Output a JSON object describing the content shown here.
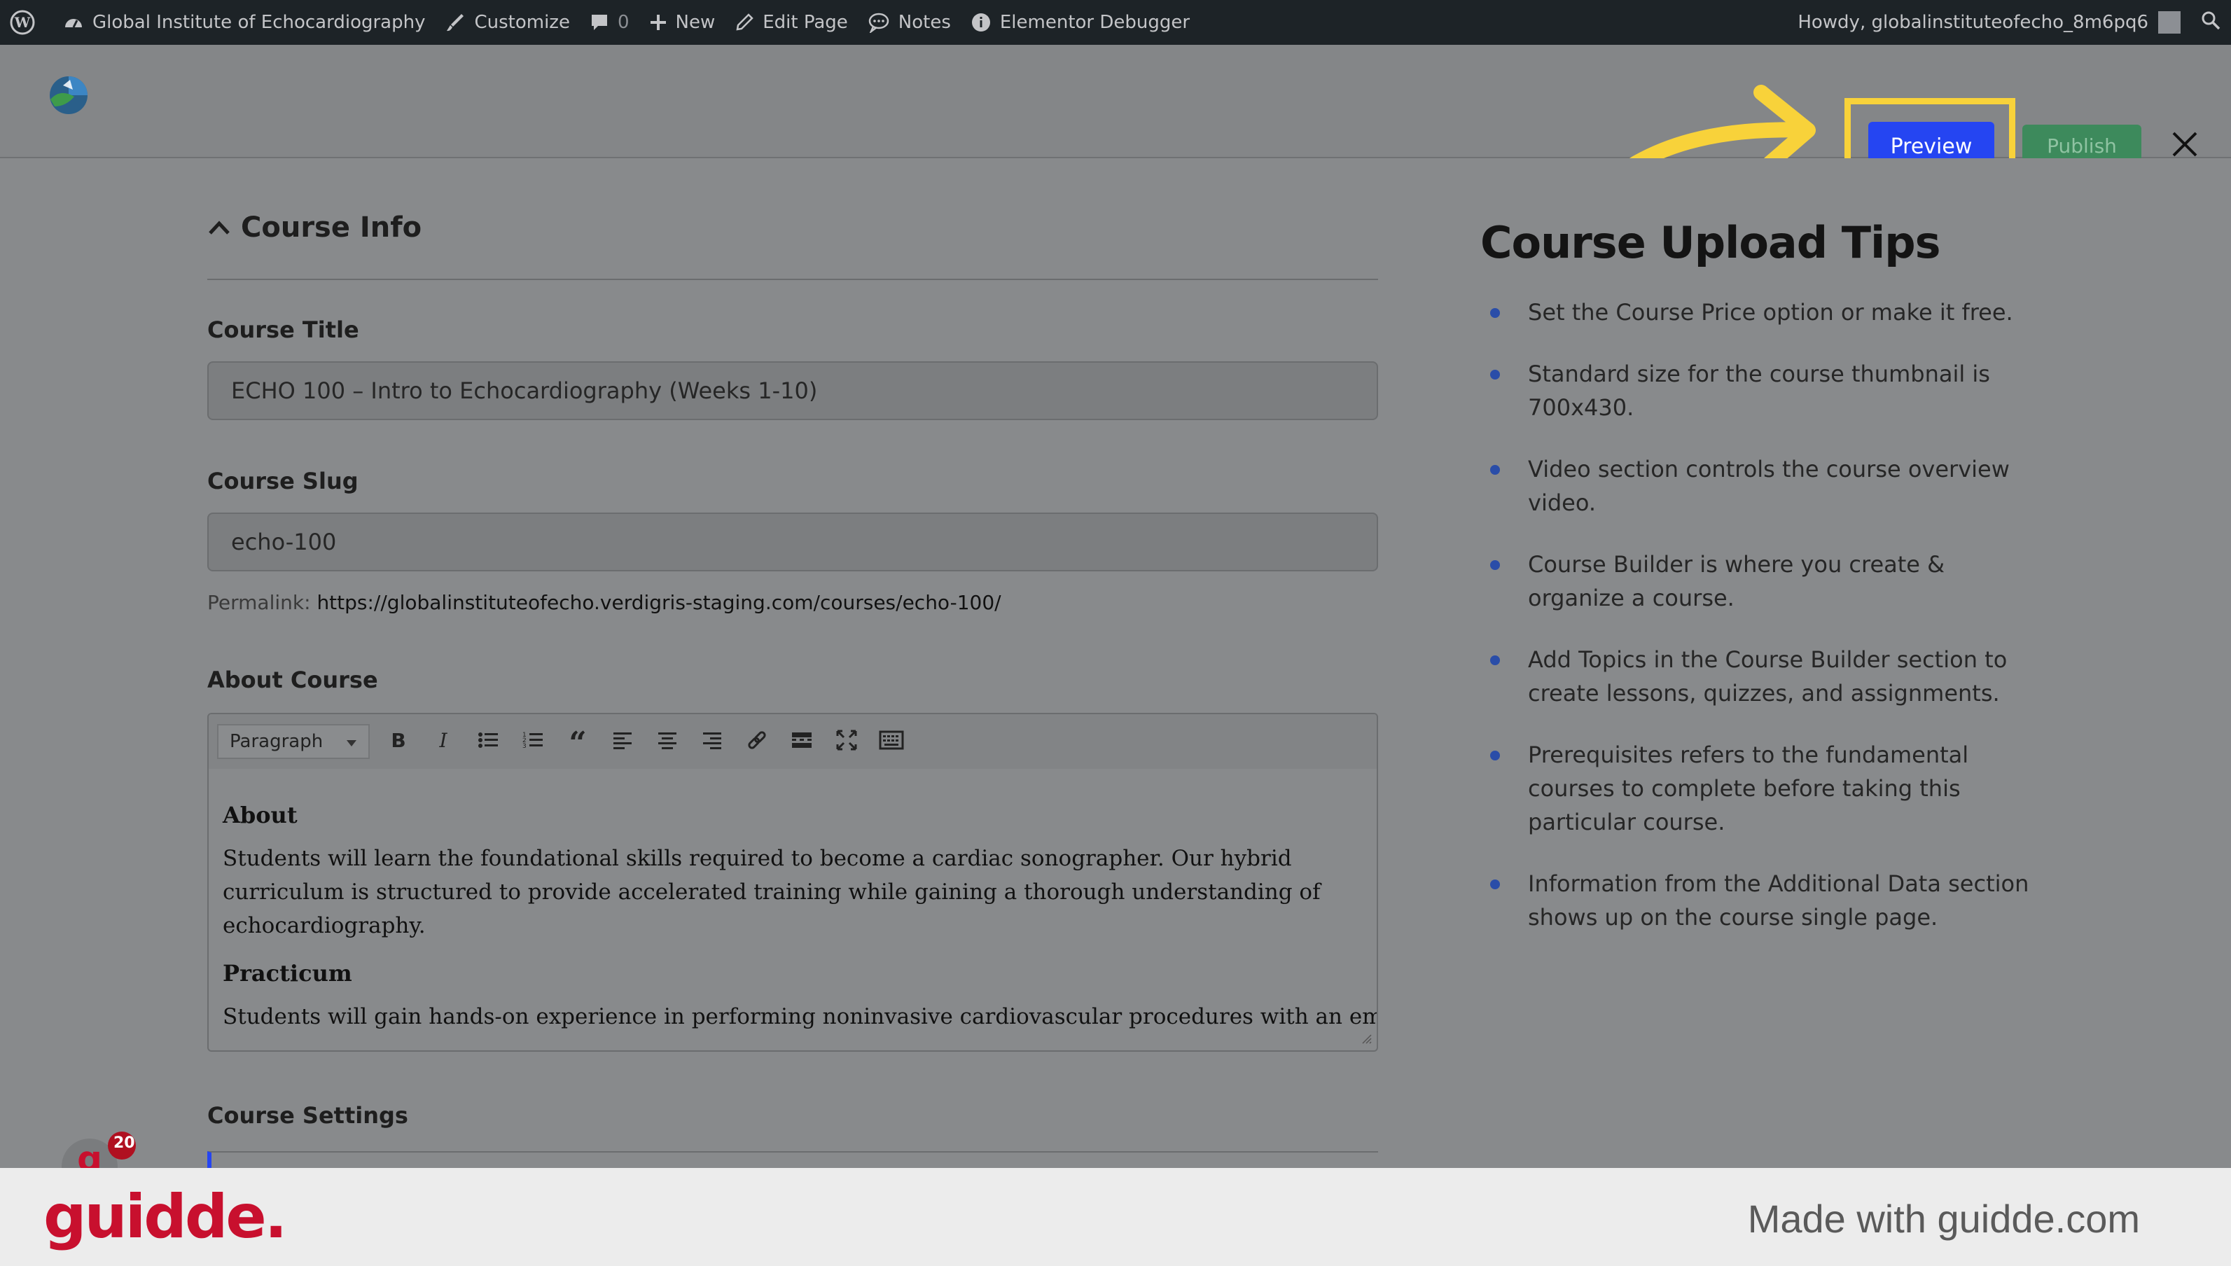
{
  "admin_bar": {
    "site_name": "Global Institute of Echocardiography",
    "customize": "Customize",
    "comments_count": "0",
    "new": "New",
    "edit_page": "Edit Page",
    "notes": "Notes",
    "elementor_debugger": "Elementor Debugger",
    "howdy": "Howdy, globalinstituteofecho_8m6pq6"
  },
  "header": {
    "preview_label": "Preview",
    "publish_label": "Publish"
  },
  "course_info": {
    "section_title": "Course Info",
    "title_label": "Course Title",
    "title_value": "ECHO 100 – Intro to Echocardiography (Weeks 1-10)",
    "slug_label": "Course Slug",
    "slug_value": "echo-100",
    "permalink_label": "Permalink:",
    "permalink_url": "https://globalinstituteofecho.verdigris-staging.com/courses/echo-100/",
    "about_label": "About Course",
    "format_select": "Paragraph",
    "editor": {
      "heading1": "About",
      "para1": "Students will learn the foundational skills required to become a cardiac sonographer. Our  hybrid curriculum is structured  to provide accelerated training while gaining a thorough understanding of echocardiography.",
      "heading2": "Practicum",
      "para2": "Students will gain hands-on experience in performing noninvasive cardiovascular procedures with an emphasis on"
    },
    "settings_label": "Course Settings"
  },
  "notification_count": "20",
  "tips": {
    "title": "Course Upload Tips",
    "items": [
      "Set the Course Price option or make it free.",
      "Standard size for the course thumbnail is 700x430.",
      "Video section controls the course overview video.",
      "Course Builder is where you create & organize a course.",
      "Add Topics in the Course Builder section to create lessons, quizzes, and assignments.",
      "Prerequisites refers to the fundamental courses to complete before taking this particular course.",
      "Information from the Additional Data section shows up on the course single page."
    ]
  },
  "footer": {
    "brand": "guidde.",
    "made_with": "Made with guidde.com"
  },
  "colors": {
    "preview_button": "#2545f2",
    "publish_button": "#3d8a5c",
    "highlight": "#f8d23a",
    "brand": "#c8102e"
  },
  "icons": [
    "wordpress-icon",
    "dashboard-icon",
    "brush-icon",
    "comment-icon",
    "plus-icon",
    "pencil-icon",
    "speech-bubble-icon",
    "info-icon",
    "search-icon",
    "close-icon",
    "chevron-up-icon",
    "bold-icon",
    "italic-icon",
    "bullet-list-icon",
    "numbered-list-icon",
    "quote-icon",
    "align-left-icon",
    "align-center-icon",
    "align-right-icon",
    "link-icon",
    "read-more-icon",
    "fullscreen-icon",
    "toolbar-toggle-icon"
  ]
}
